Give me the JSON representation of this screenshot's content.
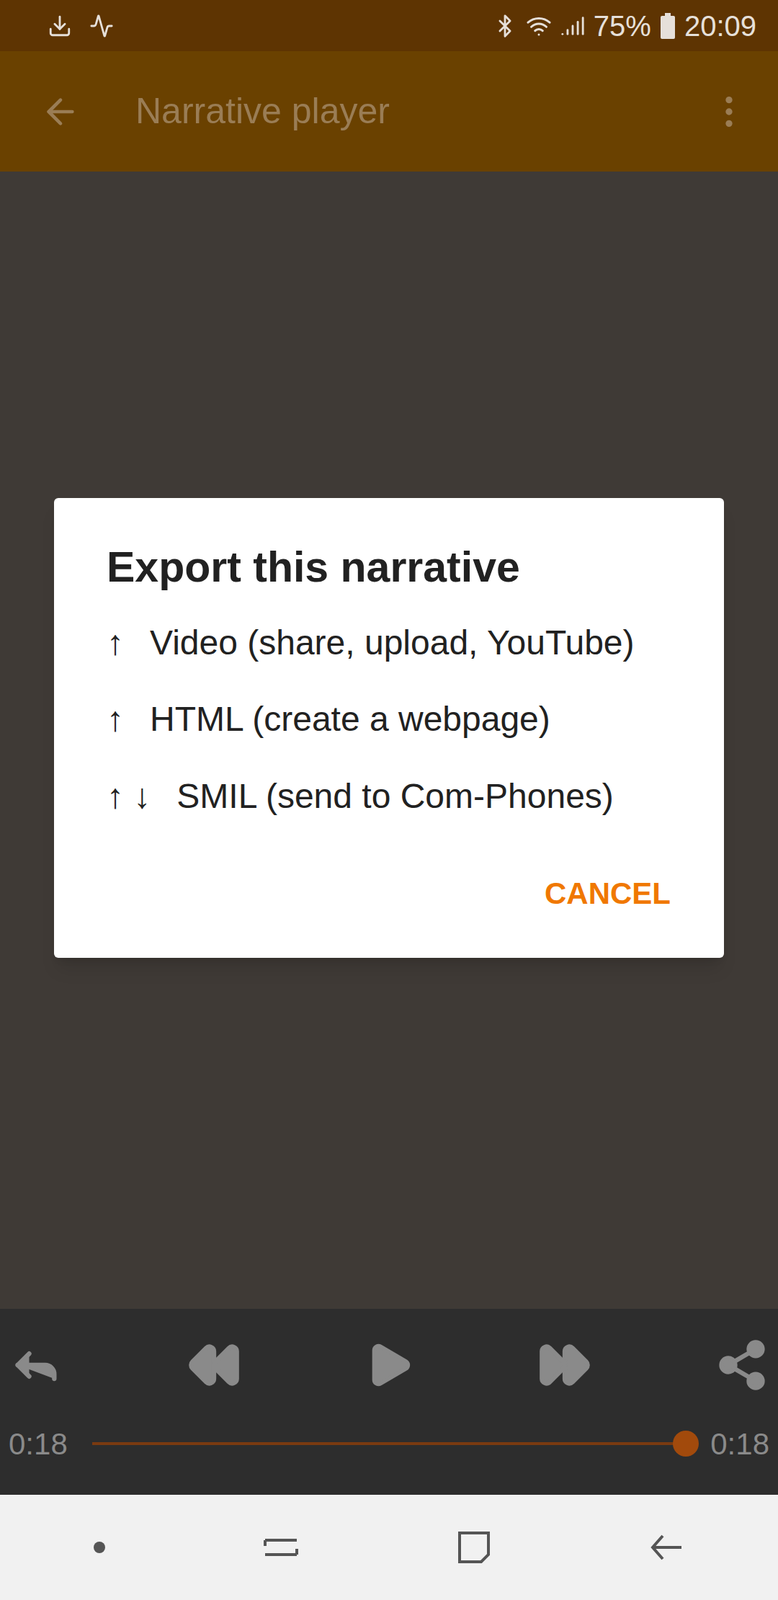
{
  "status_bar": {
    "battery": "75%",
    "time": "20:09"
  },
  "app_bar": {
    "title": "Narrative player"
  },
  "dialog": {
    "title": "Export this narrative",
    "options": [
      {
        "arrows": "↑",
        "label": "Video (share, upload, YouTube)"
      },
      {
        "arrows": "↑",
        "label": "HTML (create a webpage)"
      },
      {
        "arrows": "↑ ↓",
        "label": "SMIL (send to Com-Phones)"
      }
    ],
    "buttons": [
      "CANCEL"
    ]
  },
  "player": {
    "elapsed": "0:18",
    "duration": "0:18",
    "level": 1.0
  }
}
